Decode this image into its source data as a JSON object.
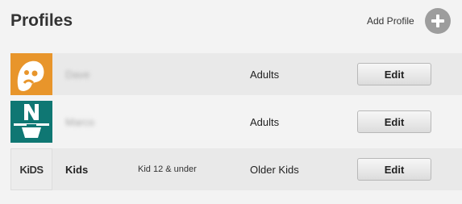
{
  "header": {
    "title": "Profiles",
    "add_profile_label": "Add Profile"
  },
  "profiles": [
    {
      "name": "Dave",
      "name_blurred": true,
      "note": "",
      "maturity": "Adults",
      "edit_label": "Edit",
      "avatar_icon": "orange-smiley-avatar-icon"
    },
    {
      "name": "Marco",
      "name_blurred": true,
      "note": "",
      "maturity": "Adults",
      "edit_label": "Edit",
      "avatar_icon": "teal-n-avatar-icon"
    },
    {
      "name": "Kids",
      "name_blurred": false,
      "note": "Kid 12 & under",
      "maturity": "Older Kids",
      "edit_label": "Edit",
      "avatar_icon": "kids-logo-icon",
      "avatar_text": "KiDS"
    }
  ],
  "colors": {
    "background": "#f3f3f3",
    "row_shaded": "#e9e9e9",
    "avatar_orange": "#e8952b",
    "avatar_teal": "#0f7773",
    "add_icon": "#9d9d9d"
  }
}
